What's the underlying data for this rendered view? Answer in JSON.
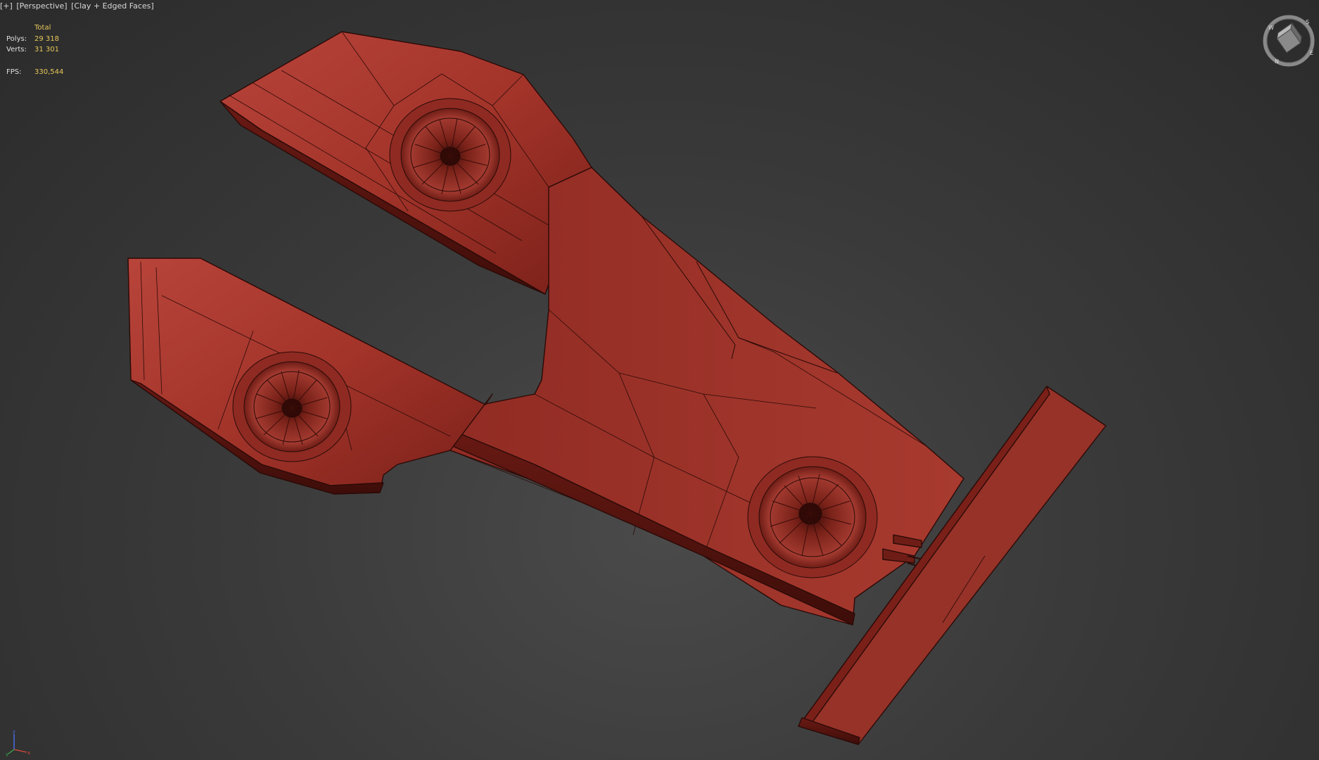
{
  "viewport": {
    "menu_label": "[+]",
    "view_label": "[Perspective]",
    "shading_label": "[Clay + Edged Faces]"
  },
  "stats": {
    "header": "Total",
    "polys_label": "Polys:",
    "polys_value": "29 318",
    "verts_label": "Verts:",
    "verts_value": "31 301",
    "fps_label": "FPS:",
    "fps_value": "330,544"
  },
  "viewcube": {
    "compass": [
      "W",
      "S",
      "E",
      "N"
    ]
  },
  "axis": {
    "x": "x",
    "y": "y",
    "z": "z"
  },
  "colors": {
    "background": "#3a3a3a",
    "clay": "#9c2e25",
    "clay_light": "#b2382d",
    "clay_dark": "#5a1510",
    "edge": "#2a0a07",
    "stats_text": "#e8c85a"
  },
  "icons": [
    "viewcube-icon",
    "axis-tripod-icon",
    "turbine-icon"
  ]
}
